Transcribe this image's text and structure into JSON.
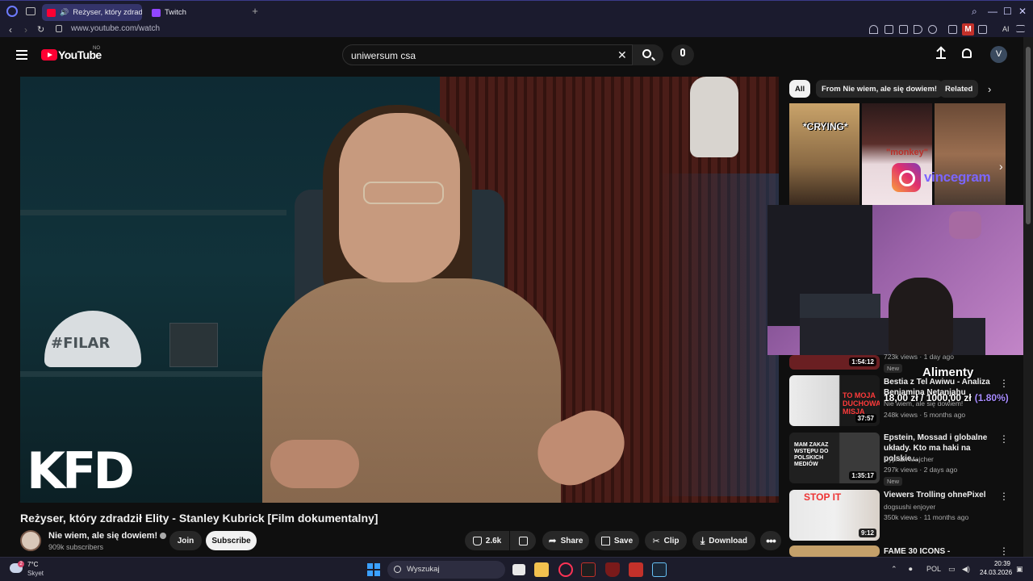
{
  "browser": {
    "tabs": [
      {
        "label": "Reżyser, który zdradz",
        "active": true,
        "favicon": "youtube-icon"
      },
      {
        "label": "Twitch",
        "active": false,
        "favicon": "twitch-icon"
      }
    ],
    "url": "www.youtube.com/watch",
    "extension_badge": "M",
    "ai_label": "AI"
  },
  "youtube": {
    "logo_text": "YouTube",
    "region": "NO",
    "search_value": "uniwersum csa",
    "avatar_letter": "V"
  },
  "video": {
    "overlay_logo": "KFD",
    "cap_text": "#FILAR",
    "title": "Reżyser, który zdradził Elity - Stanley Kubrick [Film dokumentalny]",
    "channel": "Nie wiem, ale się dowiem!",
    "subscribers": "909k subscribers",
    "join": "Join",
    "subscribe": "Subscribe",
    "likes": "2.6k",
    "share": "Share",
    "save": "Save",
    "clip": "Clip",
    "download": "Download"
  },
  "chips": [
    "All",
    "From Nie wiem, ale się dowiem!",
    "Related"
  ],
  "ad": {
    "crying": "*CRYING*",
    "monkey": "\"monkey\"",
    "instagram_name": "vincegram"
  },
  "donation": {
    "name": "Alimenty",
    "amount": "18,00 zł / 1000,00 zł",
    "percent": "(1.80%)"
  },
  "related": [
    {
      "duration": "1:54:12",
      "meta": "723k views · 1 day ago",
      "badge": "New"
    },
    {
      "title": "Bestia z Tel Awiwu - Analiza Beniamina Netanjahu",
      "channel": "Nie wiem, ale się dowiem!",
      "meta": "248k views · 5 months ago",
      "duration": "37:57",
      "thumb_text": "TO MOJA DUCHOWA MISJA"
    },
    {
      "title": "Epstein, Mossad i globalne układy. Kto ma haki na polskie...",
      "channel": "Cyprian Majcher",
      "meta": "297k views · 2 days ago",
      "badge": "New",
      "duration": "1:35:17",
      "thumb_text": "MAM ZAKAZ WSTĘPU DO POLSKICH MEDIÓW"
    },
    {
      "title": "Viewers Trolling ohnePixel",
      "channel": "dogsushi enjoyer",
      "meta": "350k views · 11 months ago",
      "duration": "9:12",
      "thumb_text": "STOP IT"
    },
    {
      "title": "FAME 30 ICONS -"
    }
  ],
  "taskbar": {
    "temp": "7°C",
    "weather": "Skyet",
    "weather_badge": "2",
    "search_placeholder": "Wyszukaj",
    "lang": "POL",
    "time": "20:39",
    "date": "24.03.2026"
  }
}
